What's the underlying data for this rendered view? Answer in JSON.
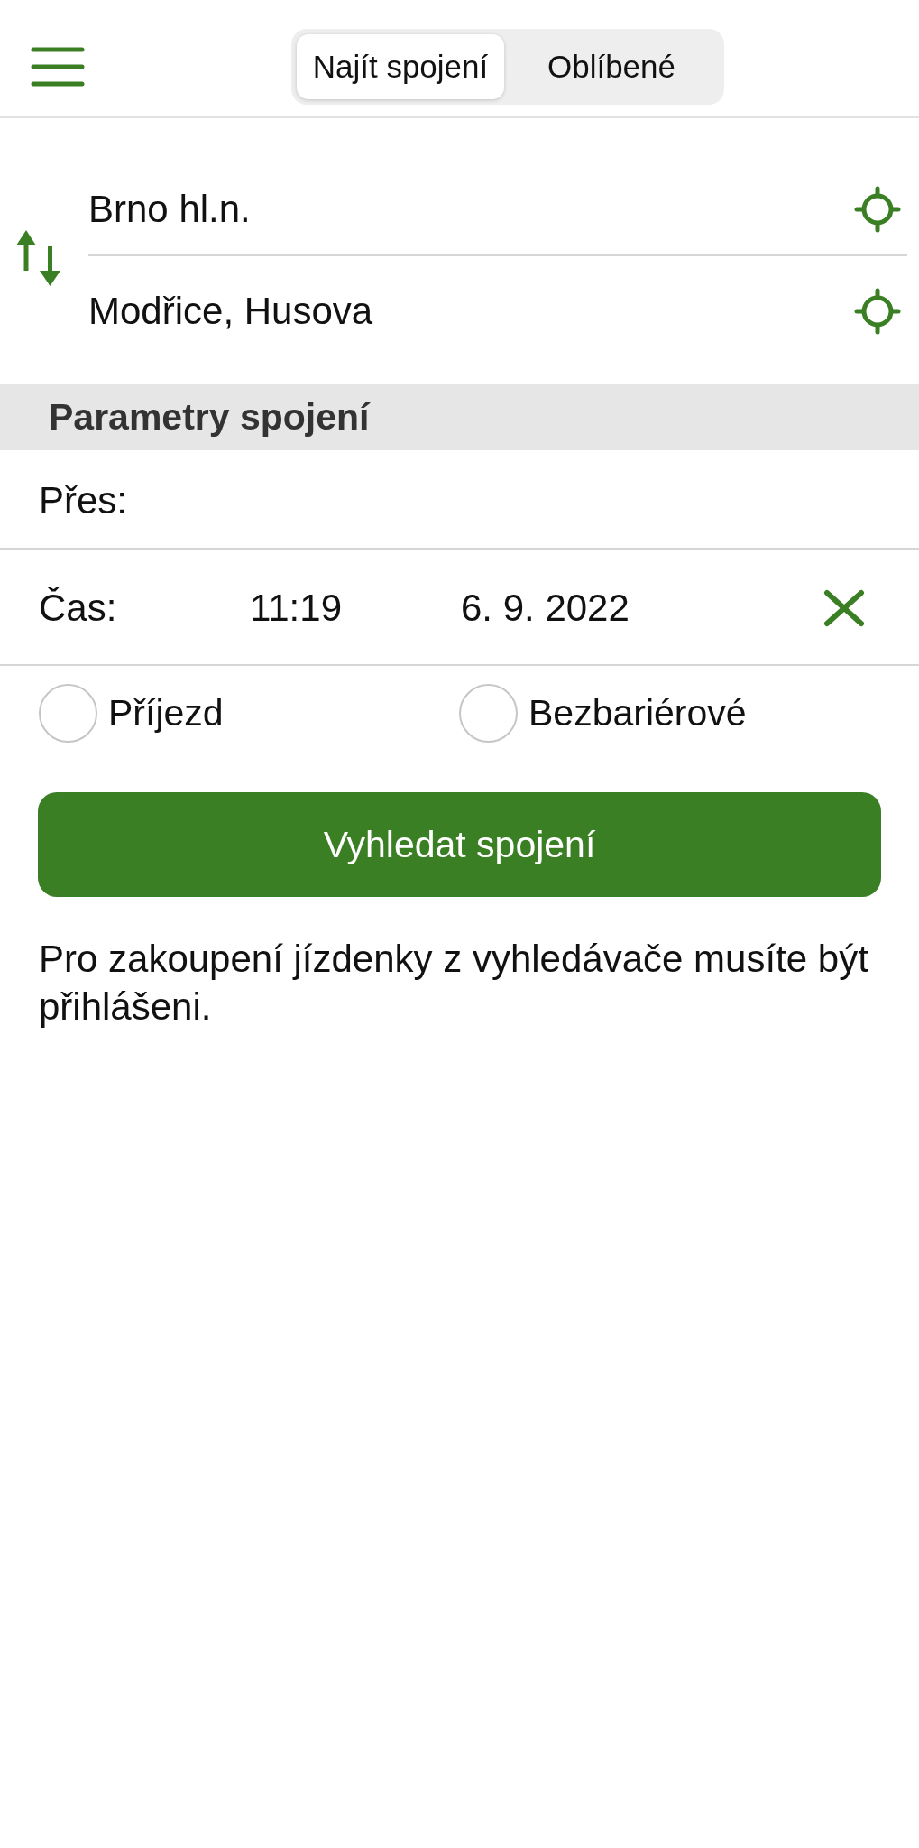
{
  "header": {
    "tabs": [
      {
        "label": "Najít spojení",
        "selected": true
      },
      {
        "label": "Oblíbené",
        "selected": false
      }
    ]
  },
  "route": {
    "from": "Brno hl.n.",
    "to": "Modřice, Husova"
  },
  "parameters": {
    "title": "Parametry spojení",
    "via_label": "Přes:",
    "time_label": "Čas:",
    "time": "11:19",
    "date": "6. 9. 2022"
  },
  "options": [
    {
      "label": "Příjezd",
      "checked": false
    },
    {
      "label": "Bezbariérové",
      "checked": false
    }
  ],
  "search_button": "Vyhledat spojení",
  "notice": "Pro zakoupení jízdenky z vyhledávače musíte být přihlášeni."
}
